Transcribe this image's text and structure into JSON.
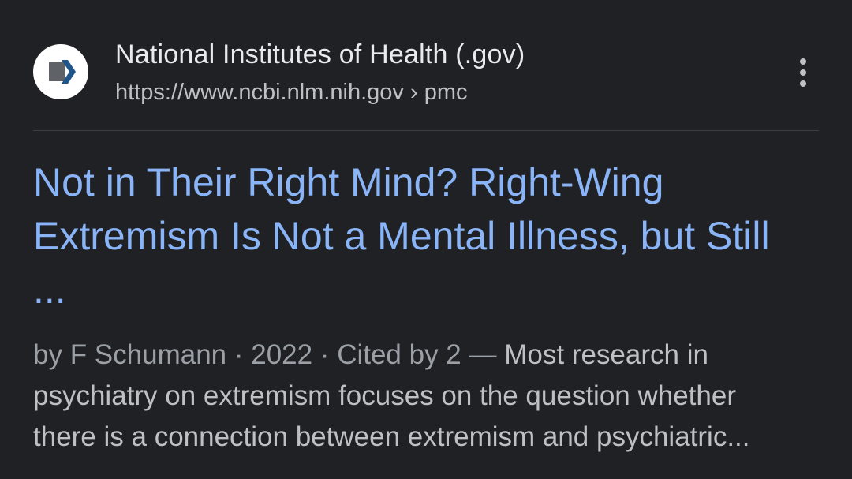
{
  "source": {
    "site_name": "National Institutes of Health (.gov)",
    "url": "https://www.ncbi.nlm.nih.gov",
    "breadcrumb_separator": "›",
    "breadcrumb": "pmc",
    "favicon_icon": "ncbi-chevron-icon",
    "favicon_colors": {
      "bg": "#ffffff",
      "block": "#5f6368",
      "chevron": "#20558a"
    }
  },
  "result": {
    "title_lines": [
      "Not in Their Right Mind? Right-Wing",
      "Extremism Is Not a Mental Illness, but Still",
      "..."
    ],
    "meta": "by F Schumann · 2022 · Cited by 2 — ",
    "snippet_lines": [
      "Most research in",
      "psychiatry on extremism focuses on the question whether",
      "there is a connection between extremism and psychiatric..."
    ]
  },
  "colors": {
    "background": "#202124",
    "title": "#8ab4f8",
    "text": "#bdc1c6",
    "site_name": "#e8eaed"
  },
  "more_icon": "more-vert-icon"
}
